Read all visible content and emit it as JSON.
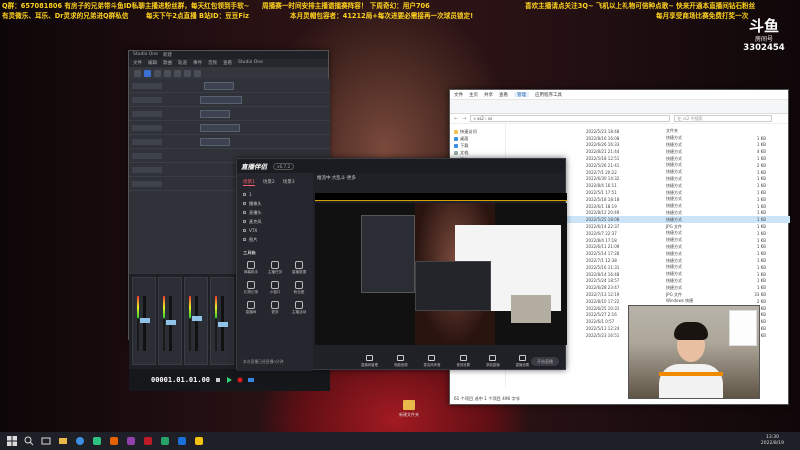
{
  "overlay": {
    "line1_left": "Q群：657081806 有房子的兄弟带斗鱼ID私聊主播进粉丝群，每天红包领到手软~",
    "line1_mid": "周播赛一时间安排主播谱擂赛阵容！ 下周奇幻：用户706",
    "line1_right": "喜欢主播请点关注3Q~ 飞机以上礼物可倍种点歌~ 快来开通本直播间钻石粉丝",
    "line2_left": "有灵微乐、耳乐、Dr灵求的兄弟进Q群私信",
    "line2_mid": "每天下午2点直播 B站ID：豆豆Fiz",
    "line2_mid2": "本月灵帽包容者：41212局+每次进要必需接再一次球员锁定!",
    "line2_right": "每月享受商场比赛免费打奖一次"
  },
  "brand": {
    "logo": "斗鱼",
    "subtitle": "房间号",
    "room_id": "3302454"
  },
  "daw": {
    "title_items": [
      "Studio One",
      "新建"
    ],
    "menu": [
      "文件",
      "编辑",
      "歌曲",
      "轨道",
      "事件",
      "音频",
      "查看",
      "Studio One"
    ],
    "time_readout": "00001.01.01.00"
  },
  "explorer": {
    "tabs": [
      "文件",
      "主页",
      "共享",
      "查看",
      "管理",
      "应用程序工具"
    ],
    "address": "« ss2 › ss",
    "search_placeholder": "在 ss2 中搜索",
    "sidebar": [
      "快速访问",
      "桌面",
      "下载",
      "文档",
      "图片",
      "此电脑",
      "网络"
    ],
    "rows": [
      {
        "name": "",
        "date": "2022/5/23 18:48",
        "type": "文件夹",
        "size": ""
      },
      {
        "name": "",
        "date": "2022/8/16 16:08",
        "type": "快捷方式",
        "size": "1 KB"
      },
      {
        "name": "",
        "date": "2022/6/26 16:33",
        "type": "快捷方式",
        "size": "1 KB"
      },
      {
        "name": "",
        "date": "2022/8/21 21:44",
        "type": "快捷方式",
        "size": "4 KB"
      },
      {
        "name": "",
        "date": "2022/5/18 12:51",
        "type": "快捷方式",
        "size": "1 KB"
      },
      {
        "name": "",
        "date": "2022/5/26 21:41",
        "type": "快捷方式",
        "size": "2 KB"
      },
      {
        "name": "",
        "date": "2022/7/1 20:22",
        "type": "快捷方式",
        "size": "1 KB"
      },
      {
        "name": "",
        "date": "2022/6/30 14:32",
        "type": "快捷方式",
        "size": "1 KB"
      },
      {
        "name": "",
        "date": "2022/8/4 16:11",
        "type": "快捷方式",
        "size": "1 KB"
      },
      {
        "name": "",
        "date": "2022/5/1 17:51",
        "type": "快捷方式",
        "size": "1 KB"
      },
      {
        "name": "",
        "date": "2022/5/18 18:18",
        "type": "快捷方式",
        "size": "1 KB"
      },
      {
        "name": "",
        "date": "2022/6/1 18:19",
        "type": "快捷方式",
        "size": "1 KB"
      },
      {
        "name": "",
        "date": "2022/8/12 20:49",
        "type": "快捷方式",
        "size": "1 KB"
      },
      {
        "name": "",
        "date": "2022/5/25 18:08",
        "type": "快捷方式",
        "size": "1 KB"
      },
      {
        "name": "",
        "date": "2022/6/14 22:37",
        "type": "JPG 文件",
        "size": "1 KB"
      },
      {
        "name": "",
        "date": "2022/6/7 22:37",
        "type": "快捷方式",
        "size": "1 KB"
      },
      {
        "name": "",
        "date": "2022/8/4 17:18",
        "type": "快捷方式",
        "size": "1 KB"
      },
      {
        "name": "",
        "date": "2022/6/11 21:09",
        "type": "快捷方式",
        "size": "1 KB"
      },
      {
        "name": "",
        "date": "2022/5/14 17:28",
        "type": "快捷方式",
        "size": "1 KB"
      },
      {
        "name": "",
        "date": "2022/7/1 12:38",
        "type": "快捷方式",
        "size": "1 KB"
      },
      {
        "name": "",
        "date": "2022/5/16 11:31",
        "type": "快捷方式",
        "size": "1 KB"
      },
      {
        "name": "",
        "date": "2022/8/14 16:48",
        "type": "快捷方式",
        "size": "1 KB"
      },
      {
        "name": "",
        "date": "2022/5/24 18:57",
        "type": "快捷方式",
        "size": "1 KB"
      },
      {
        "name": "",
        "date": "2022/6/28 23:47",
        "type": "快捷方式",
        "size": "1 KB"
      },
      {
        "name": "",
        "date": "2022/7/13 12:19",
        "type": "JPG 文件",
        "size": "33 KB"
      },
      {
        "name": "",
        "date": "2022/8/10 17:22",
        "type": "Windows 快捷",
        "size": "2 KB"
      },
      {
        "name": "",
        "date": "2022/6/25 10:31",
        "type": "快捷方式",
        "size": "1 KB"
      },
      {
        "name": "",
        "date": "2022/5/27 2:16",
        "type": "快捷方式",
        "size": "1 KB"
      },
      {
        "name": "",
        "date": "2022/6/1 0:57",
        "type": "快捷方式",
        "size": "1 KB"
      },
      {
        "name": "",
        "date": "2022/5/11 12:24",
        "type": "快捷方式",
        "size": "1 KB"
      },
      {
        "name": "",
        "date": "2022/5/23 16:51",
        "type": "快捷方式",
        "size": "1 KB"
      }
    ],
    "selected_row": 13,
    "status": "61 个项目    选中 1 个项目  496 字节"
  },
  "live": {
    "logo": "直播伴侣",
    "version": "v6.7.2",
    "tabs": [
      "场景1",
      "场景2",
      "场景3"
    ],
    "sources": [
      "1",
      "摄像头",
      "直播头",
      "麦克风",
      "VTX",
      "图片"
    ],
    "tool_header": "工具箱",
    "tools": [
      "弹幕助手",
      "主播任务",
      "直播数据",
      "礼物记录",
      "小窗口",
      "粉丝团",
      "直播间",
      "更多",
      "主播活动"
    ],
    "preview_title": "推流中·大乱斗·更多",
    "bottom_actions": [
      "直播间管理",
      "电脑音频",
      "麦克风声音",
      "音效设置",
      "录制直播",
      "直播设置"
    ],
    "start_label": "开始直播",
    "footer": "本次直播已经直播0分钟"
  },
  "desktop_icon": "新建文件夹",
  "taskbar": {
    "time": "13:30",
    "date": "2022/8/19"
  }
}
